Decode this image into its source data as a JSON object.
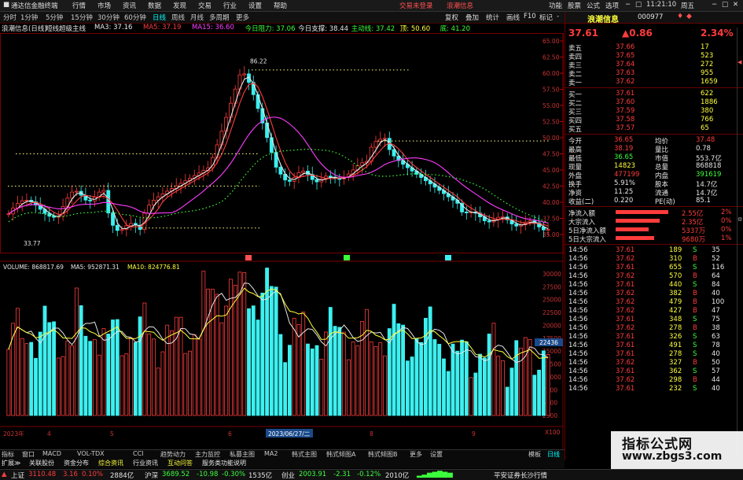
{
  "titlebar": {
    "app_name": "通达信金融终端",
    "menus": [
      "行情",
      "市场",
      "资讯",
      "数据",
      "发现",
      "交易",
      "行业",
      "设置",
      "帮助"
    ],
    "login_status": "交易未登录",
    "stock_tag": "浪潮信息",
    "right_items": [
      "功能",
      "股票",
      "公式",
      "选项"
    ],
    "time": "11:21:10",
    "weekday": "周五"
  },
  "tabbar": {
    "periods": [
      "分时",
      "1分钟",
      "5分钟",
      "15分钟",
      "30分钟",
      "60分钟",
      "日线",
      "周线",
      "月线",
      "多周期",
      "更多"
    ],
    "active_index": 6,
    "right_tools": [
      "复权",
      "叠加",
      "统计",
      "画线",
      "F10",
      "标记",
      "-"
    ]
  },
  "main_chart": {
    "stock_label": "浪潮信息(日线)",
    "indicator_name": "短线超级主线",
    "items": [
      {
        "text": "MA3: 37.16",
        "color": "#e6e6e6"
      },
      {
        "text": "MA5: 37.19",
        "color": "#ff3c3c"
      },
      {
        "text": "MA15: 36.60",
        "color": "#ff3cff"
      },
      {
        "text": "今日阻力: 37.06",
        "color": "#3cff3c"
      },
      {
        "text": "今日支撑: 38.44",
        "color": "#e6e6e6"
      },
      {
        "text": "主动线: 37.42",
        "color": "#3cff3c"
      },
      {
        "text": "顶: 50.60",
        "color": "#ffff3c"
      },
      {
        "text": "底: 41.20",
        "color": "#3cff3c"
      }
    ],
    "price_axis": [
      "65.00",
      "62.50",
      "60.00",
      "57.50",
      "55.00",
      "52.50",
      "50.00",
      "47.50",
      "45.00",
      "42.50",
      "40.00",
      "37.50",
      "35.00"
    ],
    "high_label": "86.22",
    "low_label": "33.77",
    "markers": [
      "压",
      "减",
      "顶"
    ]
  },
  "volume_chart": {
    "label": "VOLUME: 868817.69",
    "ma5": "MA5: 952871.31",
    "ma10": "MA10: 824776.81",
    "axis": [
      "30000",
      "27500",
      "25000",
      "22500",
      "20000",
      "17500",
      "15000",
      "12500",
      "10000",
      "7500",
      "5000",
      "2500"
    ],
    "current_tag": "22436",
    "unit": "X100",
    "date_labels": [
      "2023年",
      "4",
      "5",
      "6",
      "8",
      "9"
    ],
    "cursor_date": "2023/06/27/二"
  },
  "bottom_tabs": [
    "指标",
    "窗口",
    "MACD",
    "VOL-TDX",
    "CCI",
    "趋势动力",
    "主力监控",
    "私募主图",
    "MA2",
    "韩式主图",
    "韩式倾图A",
    "韩式倾图B",
    "更多",
    "设置"
  ],
  "bottom_tabs2": [
    "扩展≫",
    "关联股份",
    "资金分布",
    "综合资讯",
    "行业资讯",
    "互动问答",
    "服务类功能说明"
  ],
  "bottom_right": [
    "模板",
    "日线"
  ],
  "quote": {
    "name": "浪潮信息",
    "code": "000977",
    "price": "37.61",
    "change": "▲0.86",
    "pct": "2.34%",
    "asks": [
      {
        "label": "卖五",
        "price": "37.66",
        "vol": "17"
      },
      {
        "label": "卖四",
        "price": "37.65",
        "vol": "523"
      },
      {
        "label": "卖三",
        "price": "37.64",
        "vol": "272"
      },
      {
        "label": "卖二",
        "price": "37.63",
        "vol": "955"
      },
      {
        "label": "卖一",
        "price": "37.62",
        "vol": "1659"
      }
    ],
    "bids": [
      {
        "label": "买一",
        "price": "37.61",
        "vol": "622"
      },
      {
        "label": "买二",
        "price": "37.60",
        "vol": "1886"
      },
      {
        "label": "买三",
        "price": "37.59",
        "vol": "380"
      },
      {
        "label": "买四",
        "price": "37.58",
        "vol": "766"
      },
      {
        "label": "买五",
        "price": "37.57",
        "vol": "65"
      }
    ],
    "stats": [
      {
        "l1": "今开",
        "v1": "36.65",
        "c1": "#ff3c3c",
        "l2": "均价",
        "v2": "37.48",
        "c2": "#ff3c3c"
      },
      {
        "l1": "最高",
        "v1": "38.19",
        "c1": "#ff3c3c",
        "l2": "量比",
        "v2": "0.78",
        "c2": "#e6e6e6"
      },
      {
        "l1": "最低",
        "v1": "36.65",
        "c1": "#3cff3c",
        "l2": "市值",
        "v2": "553.7亿",
        "c2": "#e6e6e6"
      },
      {
        "l1": "现量",
        "v1": "14823",
        "c1": "#ffff3c",
        "l2": "总量",
        "v2": "868818",
        "c2": "#e6e6e6"
      },
      {
        "l1": "外盘",
        "v1": "477199",
        "c1": "#ff3c3c",
        "l2": "内盘",
        "v2": "391619",
        "c2": "#3cff3c"
      },
      {
        "l1": "换手",
        "v1": "5.91%",
        "c1": "#e6e6e6",
        "l2": "股本",
        "v2": "14.7亿",
        "c2": "#e6e6e6"
      },
      {
        "l1": "净资",
        "v1": "11.25",
        "c1": "#e6e6e6",
        "l2": "流通",
        "v2": "14.7亿",
        "c2": "#e6e6e6"
      },
      {
        "l1": "收益(二)",
        "v1": "0.220",
        "c1": "#e6e6e6",
        "l2": "PE(动)",
        "v2": "85.1",
        "c2": "#e6e6e6"
      }
    ],
    "flows": [
      {
        "label": "净流入额",
        "value": "2.55亿",
        "pct": "2%",
        "bar": 0.95
      },
      {
        "label": "大宗流入",
        "value": "2.35亿",
        "pct": "0%",
        "bar": 0.8
      },
      {
        "label": "5日净流入额",
        "value": "5337万",
        "pct": "0%",
        "bar": 0.6
      },
      {
        "label": "5日大宗流入",
        "value": "9680万",
        "pct": "1%",
        "bar": 0.7
      }
    ],
    "ticks": [
      {
        "t": "14:56",
        "p": "37.61",
        "v": "189",
        "s": "S",
        "n": "35"
      },
      {
        "t": "14:56",
        "p": "37.62",
        "v": "310",
        "s": "B",
        "n": "52"
      },
      {
        "t": "14:56",
        "p": "37.61",
        "v": "655",
        "s": "S",
        "n": "116"
      },
      {
        "t": "14:56",
        "p": "37.62",
        "v": "570",
        "s": "B",
        "n": "64"
      },
      {
        "t": "14:56",
        "p": "37.61",
        "v": "440",
        "s": "S",
        "n": "84"
      },
      {
        "t": "14:56",
        "p": "37.62",
        "v": "382",
        "s": "B",
        "n": "40"
      },
      {
        "t": "14:56",
        "p": "37.62",
        "v": "479",
        "s": "B",
        "n": "100"
      },
      {
        "t": "14:56",
        "p": "37.62",
        "v": "427",
        "s": "B",
        "n": "47"
      },
      {
        "t": "14:56",
        "p": "37.61",
        "v": "348",
        "s": "S",
        "n": "75"
      },
      {
        "t": "14:56",
        "p": "37.62",
        "v": "278",
        "s": "B",
        "n": "38"
      },
      {
        "t": "14:56",
        "p": "37.61",
        "v": "326",
        "s": "S",
        "n": "63"
      },
      {
        "t": "14:56",
        "p": "37.61",
        "v": "491",
        "s": "S",
        "n": "78"
      },
      {
        "t": "14:56",
        "p": "37.61",
        "v": "278",
        "s": "S",
        "n": "40"
      },
      {
        "t": "14:56",
        "p": "37.62",
        "v": "327",
        "s": "B",
        "n": "50"
      },
      {
        "t": "14:56",
        "p": "37.61",
        "v": "362",
        "s": "S",
        "n": "57"
      },
      {
        "t": "14:56",
        "p": "37.62",
        "v": "298",
        "s": "B",
        "n": "44"
      },
      {
        "t": "14:56",
        "p": "37.61",
        "v": "232",
        "s": "S",
        "n": "40"
      }
    ]
  },
  "statusbar": {
    "items": [
      {
        "text": "上证",
        "color": "#e6e6e6"
      },
      {
        "text": "3110.48",
        "color": "#ff3c3c"
      },
      {
        "text": "3.16",
        "color": "#ff3c3c"
      },
      {
        "text": "0.10%",
        "color": "#ff3c3c"
      },
      {
        "text": "2884亿",
        "color": "#e6e6e6"
      },
      {
        "text": "沪深",
        "color": "#e6e6e6"
      },
      {
        "text": "3689.52",
        "color": "#3cff3c"
      },
      {
        "text": "-10.98",
        "color": "#3cff3c"
      },
      {
        "text": "-0.30%",
        "color": "#3cff3c"
      },
      {
        "text": "1535亿",
        "color": "#e6e6e6"
      },
      {
        "text": "创业",
        "color": "#e6e6e6"
      },
      {
        "text": "2003.91",
        "color": "#3cff3c"
      },
      {
        "text": "-2.31",
        "color": "#3cff3c"
      },
      {
        "text": "-0.12%",
        "color": "#3cff3c"
      },
      {
        "text": "2010亿",
        "color": "#e6e6e6"
      },
      {
        "text": "平安证券长沙行情",
        "color": "#e6e6e6"
      }
    ]
  },
  "watermark": {
    "line1": "指标公式网",
    "line2": "www.zbgs3.com"
  }
}
